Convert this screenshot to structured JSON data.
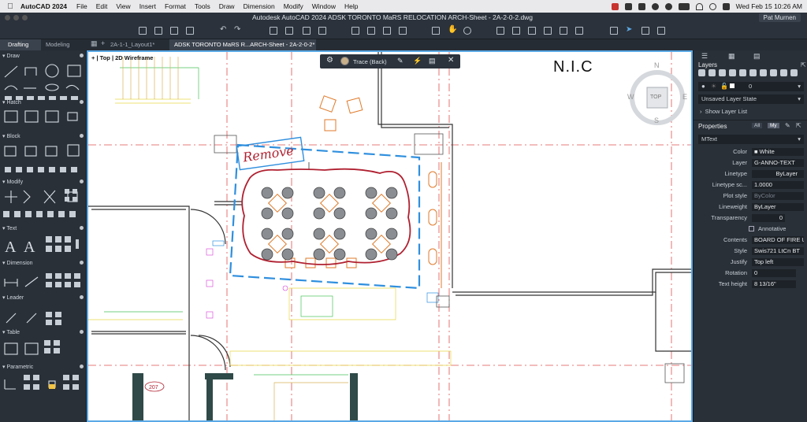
{
  "menubar": {
    "app_name": "AutoCAD 2024",
    "items": [
      "File",
      "Edit",
      "View",
      "Insert",
      "Format",
      "Tools",
      "Draw",
      "Dimension",
      "Modify",
      "Window",
      "Help"
    ],
    "clock": "Wed Feb 15  10:26 AM"
  },
  "titlebar": {
    "title": "Autodesk AutoCAD 2024   ADSK TORONTO MaRS RELOCATION ARCH-Sheet - 2A-2-0-2.dwg",
    "user": "Pat Murnen"
  },
  "tabs": {
    "left_tabs": [
      "Drafting",
      "Modeling"
    ],
    "doc_tabs": [
      "2A-1-1_Layout1*",
      "ADSK TORONTO MaRS R...ARCH-Sheet - 2A-2-0-2*"
    ]
  },
  "palette": {
    "sections": [
      "Draw",
      "Hatch",
      "Block",
      "Modify",
      "Text",
      "Dimension",
      "Leader",
      "Table",
      "Parametric"
    ]
  },
  "viewport": {
    "label_plus": "+",
    "view": "Top",
    "style": "2D Wireframe"
  },
  "trace": {
    "label": "Trace (Back)"
  },
  "drawing": {
    "nic_text": "N.I.C",
    "remove_text": "Remove",
    "tag_207": "207"
  },
  "viewcube": {
    "n": "N",
    "s": "S",
    "e": "E",
    "w": "W",
    "top": "TOP"
  },
  "layers": {
    "title": "Layers",
    "current_layer": "0",
    "layer_state": "Unsaved Layer State",
    "show_list": "Show Layer List"
  },
  "properties": {
    "title": "Properties",
    "tab_all": "All",
    "tab_my": "My",
    "object_type": "MText",
    "rows": [
      {
        "label": "Color",
        "value": "White"
      },
      {
        "label": "Layer",
        "value": "G-ANNO-TEXT"
      },
      {
        "label": "Linetype",
        "value": "ByLayer"
      },
      {
        "label": "Linetype sc...",
        "value": "1.0000"
      },
      {
        "label": "Plot style",
        "value": "ByColor"
      },
      {
        "label": "Lineweight",
        "value": "ByLayer"
      },
      {
        "label": "Transparency",
        "value": "0"
      },
      {
        "label": "Annotative",
        "value": ""
      },
      {
        "label": "Contents",
        "value": "BOARD OF FIRE U..."
      },
      {
        "label": "Style",
        "value": "Swis721 LtCn BT"
      },
      {
        "label": "Justify",
        "value": "Top left"
      },
      {
        "label": "Rotation",
        "value": "0"
      },
      {
        "label": "Text height",
        "value": "8 13/16\""
      }
    ]
  },
  "colors": {
    "accent_blue": "#2f8fde",
    "markup_red": "#b02030",
    "trace_border": "#5aa9e6"
  }
}
